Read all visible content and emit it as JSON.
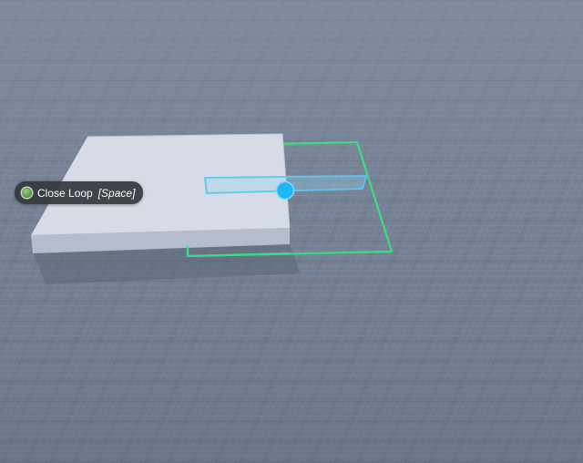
{
  "tooltip": {
    "action_label": "Close Loop",
    "key_label": "[Space]",
    "indicator_icon": "green-status-dot-icon"
  },
  "scene": {
    "floor_color": "#6f7b8f",
    "block_top_color": "#d7dbe5",
    "block_side_color": "#b5bccb",
    "outline_color": "#3ddc84",
    "selection_color": "#5cc8f2",
    "handle_color": "#1fb6f5"
  }
}
